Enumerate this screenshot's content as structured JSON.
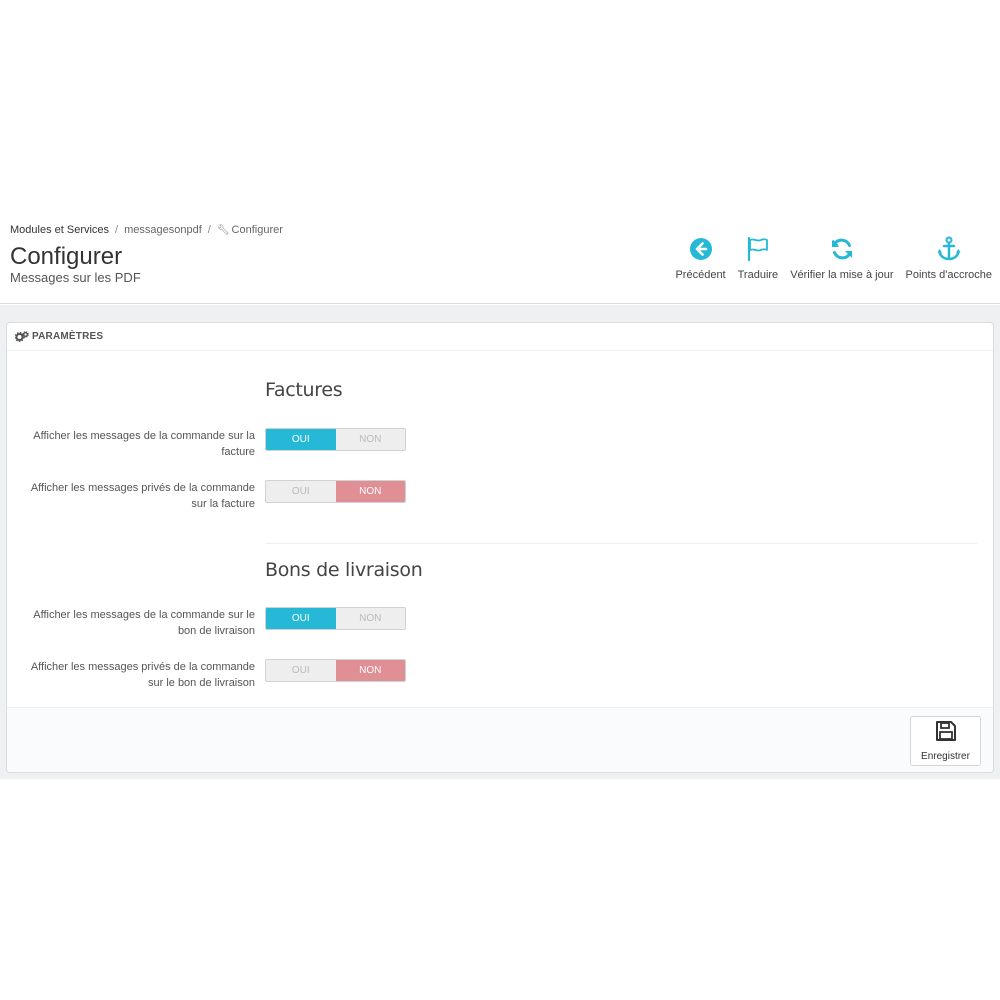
{
  "breadcrumb": {
    "items": [
      "Modules et Services",
      "messagesonpdf",
      "Configurer"
    ],
    "separator": "/"
  },
  "header": {
    "title": "Configurer",
    "subtitle": "Messages sur les PDF"
  },
  "toolbar": {
    "accent_color": "#25b9d7",
    "buttons": [
      {
        "label": "Précédent",
        "icon": "circle-arrow-left-icon"
      },
      {
        "label": "Traduire",
        "icon": "flag-icon"
      },
      {
        "label": "Vérifier la mise à jour",
        "icon": "refresh-icon"
      },
      {
        "label": "Points d'accroche",
        "icon": "anchor-icon"
      }
    ]
  },
  "panel": {
    "heading": "PARAMÈTRES",
    "heading_icon": "gears-icon"
  },
  "sections": [
    {
      "title": "Factures",
      "fields": [
        {
          "label": "Afficher les messages de la commande sur la facture",
          "yes": "OUI",
          "no": "NON",
          "value": "yes"
        },
        {
          "label": "Afficher les messages privés de la commande sur la facture",
          "yes": "OUI",
          "no": "NON",
          "value": "no"
        }
      ]
    },
    {
      "title": "Bons de livraison",
      "fields": [
        {
          "label": "Afficher les messages de la commande sur le bon de livraison",
          "yes": "OUI",
          "no": "NON",
          "value": "yes"
        },
        {
          "label": "Afficher les messages privés de la commande sur le bon de livraison",
          "yes": "OUI",
          "no": "NON",
          "value": "no"
        }
      ]
    }
  ],
  "footer": {
    "save_label": "Enregistrer",
    "save_icon": "floppy-disk-icon"
  },
  "colors": {
    "yes_active": "#25b9d7",
    "no_active": "#e08f95"
  }
}
